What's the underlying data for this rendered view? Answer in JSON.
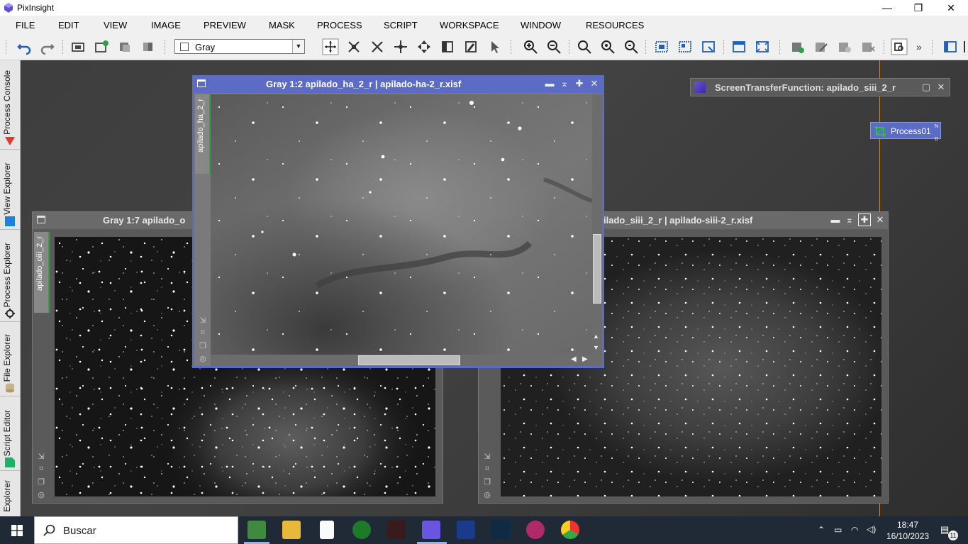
{
  "window": {
    "title": "PixInsight",
    "minimize": "—",
    "maximize": "❐",
    "close": "✕"
  },
  "menu": [
    "FILE",
    "EDIT",
    "VIEW",
    "IMAGE",
    "PREVIEW",
    "MASK",
    "PROCESS",
    "SCRIPT",
    "WORKSPACE",
    "WINDOW",
    "RESOURCES"
  ],
  "toolbar": {
    "channel_combo": "Gray",
    "more": "»"
  },
  "sidebar": {
    "tabs": [
      "Process Console",
      "View Explorer",
      "Process Explorer",
      "File Explorer",
      "Script Editor",
      "Explorer"
    ]
  },
  "windows": {
    "ha": {
      "title": "Gray 1:2 apilado_ha_2_r | apilado-ha-2_r.xisf",
      "tab": "apilado_ha_2_r"
    },
    "oiii": {
      "title": "Gray 1:7 apilado_o",
      "tab": "apilado_oiii_2_r"
    },
    "siii": {
      "title": "ilado_siii_2_r | apilado-siii-2_r.xisf"
    }
  },
  "stf": {
    "title": "ScreenTransferFunction: apilado_siii_2_r"
  },
  "process_icon": {
    "label": "Process01",
    "corner_top": "N",
    "corner_bottom": "D"
  },
  "taskbar": {
    "search_placeholder": "Buscar",
    "time": "18:47",
    "date": "16/10/2023",
    "notifications": "11"
  },
  "colors": {
    "active_window": "#5c6cc4",
    "taskbar": "#1f2a36",
    "accent_orange": "#c48a3a"
  }
}
